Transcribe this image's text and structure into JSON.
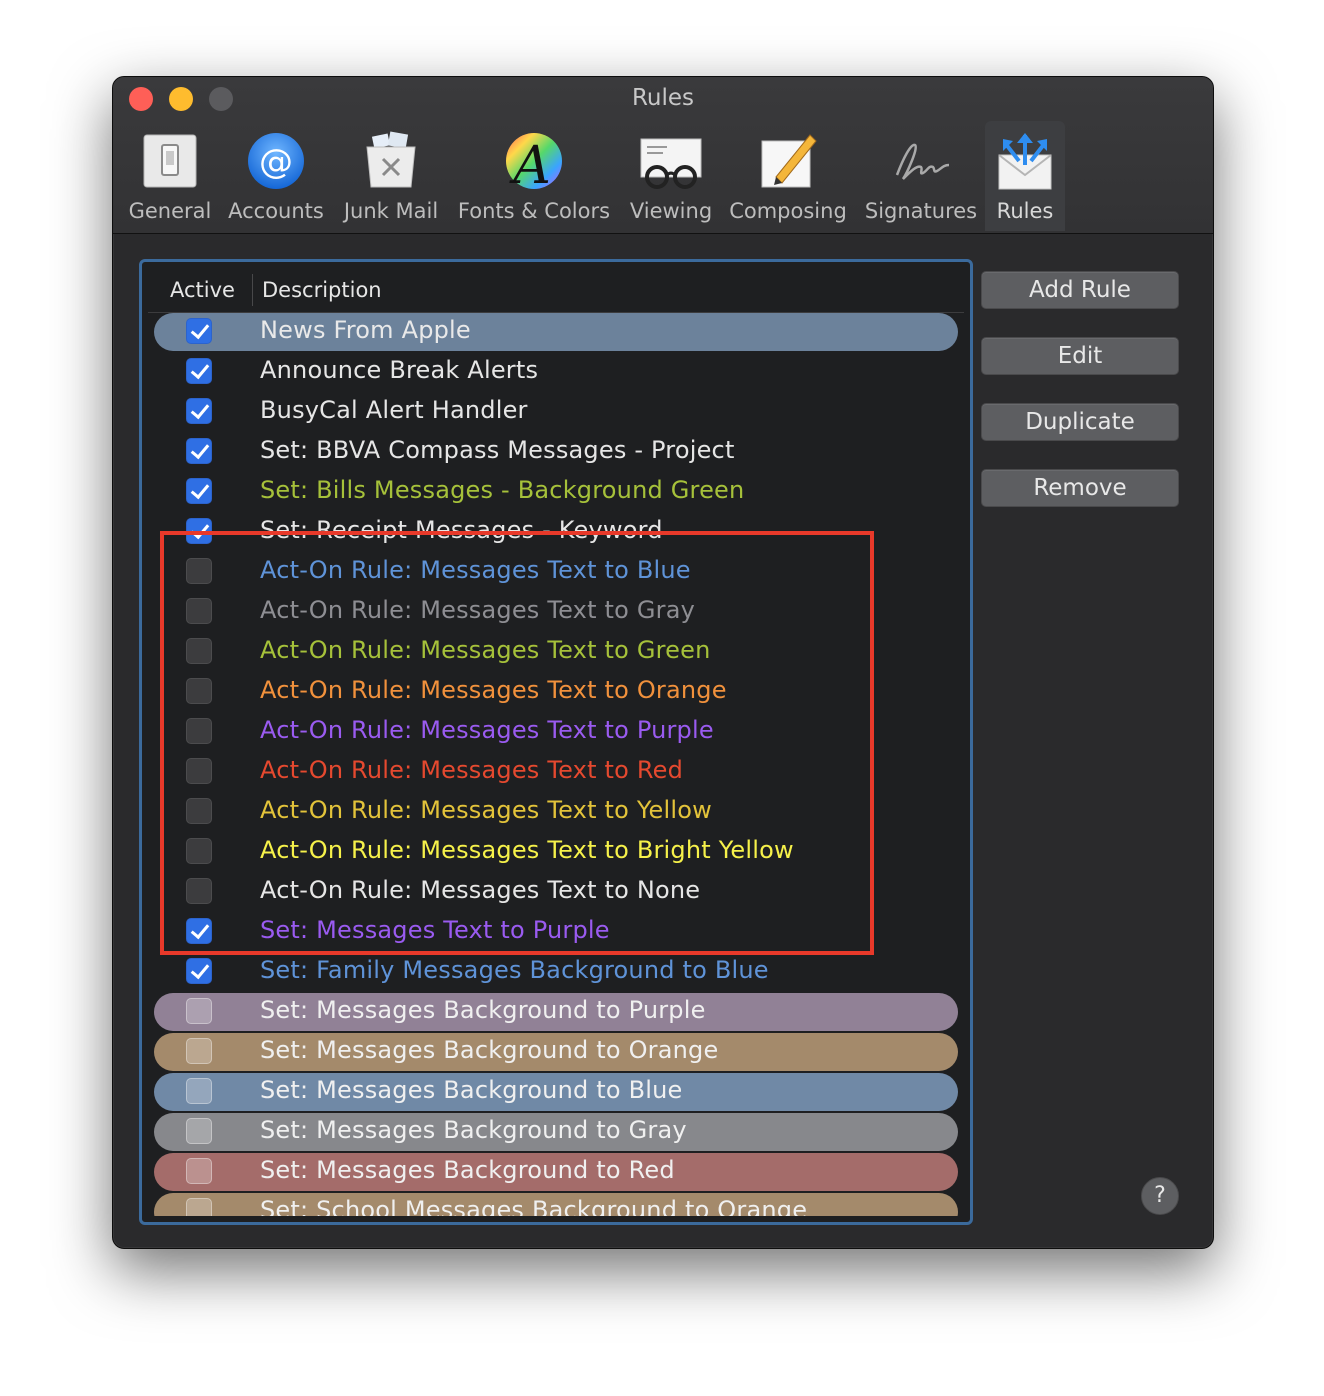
{
  "window": {
    "title": "Rules"
  },
  "toolbar": {
    "items": [
      {
        "label": "General",
        "icon": "general-icon"
      },
      {
        "label": "Accounts",
        "icon": "at-sign-icon"
      },
      {
        "label": "Junk Mail",
        "icon": "trash-basket-icon"
      },
      {
        "label": "Fonts & Colors",
        "icon": "fonts-colors-icon"
      },
      {
        "label": "Viewing",
        "icon": "glasses-icon"
      },
      {
        "label": "Composing",
        "icon": "pencil-paper-icon"
      },
      {
        "label": "Signatures",
        "icon": "signature-icon"
      },
      {
        "label": "Rules",
        "icon": "rules-envelope-icon"
      }
    ],
    "selected": "Rules"
  },
  "table": {
    "columns": [
      "Active",
      "Description"
    ],
    "rows": [
      {
        "active": true,
        "label": "News From Apple",
        "text_color": "#e9e9e9",
        "bg_color": "#6c829b"
      },
      {
        "active": true,
        "label": "Announce Break Alerts",
        "text_color": "#e6e6e6",
        "bg_color": ""
      },
      {
        "active": true,
        "label": "BusyCal Alert Handler",
        "text_color": "#e6e6e6",
        "bg_color": ""
      },
      {
        "active": true,
        "label": "Set: BBVA Compass Messages - Project",
        "text_color": "#e6e6e6",
        "bg_color": ""
      },
      {
        "active": true,
        "label": "Set: Bills Messages - Background Green",
        "text_color": "#a6c13a",
        "bg_color": ""
      },
      {
        "active": true,
        "label": "Set: Receipt Messages - Keyword",
        "text_color": "#e6e6e6",
        "bg_color": ""
      },
      {
        "active": false,
        "label": "Act-On Rule: Messages Text to Blue",
        "text_color": "#5f93d8",
        "bg_color": ""
      },
      {
        "active": false,
        "label": "Act-On Rule: Messages Text to Gray",
        "text_color": "#8e8e93",
        "bg_color": ""
      },
      {
        "active": false,
        "label": "Act-On Rule: Messages Text to Green",
        "text_color": "#a6c13a",
        "bg_color": ""
      },
      {
        "active": false,
        "label": "Act-On Rule: Messages Text to Orange",
        "text_color": "#f1913c",
        "bg_color": ""
      },
      {
        "active": false,
        "label": "Act-On Rule: Messages Text to Purple",
        "text_color": "#9a5bf0",
        "bg_color": ""
      },
      {
        "active": false,
        "label": "Act-On Rule: Messages Text to Red",
        "text_color": "#e5492f",
        "bg_color": ""
      },
      {
        "active": false,
        "label": "Act-On Rule: Messages Text to Yellow",
        "text_color": "#e3c33a",
        "bg_color": ""
      },
      {
        "active": false,
        "label": "Act-On Rule: Messages Text to Bright Yellow",
        "text_color": "#f6f14a",
        "bg_color": ""
      },
      {
        "active": false,
        "label": "Act-On Rule: Messages Text to None",
        "text_color": "#e6e6e6",
        "bg_color": ""
      },
      {
        "active": true,
        "label": "Set: Messages Text to Purple",
        "text_color": "#9a5bf0",
        "bg_color": ""
      },
      {
        "active": true,
        "label": "Set: Family Messages Background to Blue",
        "text_color": "#5f93d8",
        "bg_color": ""
      },
      {
        "active": false,
        "label": "Set: Messages Background to Purple",
        "text_color": "#f0f0f0",
        "bg_color": "#918196"
      },
      {
        "active": false,
        "label": "Set: Messages Background to Orange",
        "text_color": "#f0f0f0",
        "bg_color": "#a48a6b"
      },
      {
        "active": false,
        "label": "Set: Messages Background to Blue",
        "text_color": "#f0f0f0",
        "bg_color": "#7089a6"
      },
      {
        "active": false,
        "label": "Set: Messages Background to Gray",
        "text_color": "#f0f0f0",
        "bg_color": "#87888c"
      },
      {
        "active": false,
        "label": "Set: Messages Background to Red",
        "text_color": "#f0f0f0",
        "bg_color": "#a46c6a"
      },
      {
        "active": false,
        "label": "Set: School Messages Background to Orange",
        "text_color": "#f0f0f0",
        "bg_color": "#a48a6b"
      }
    ]
  },
  "buttons": {
    "add_rule": "Add Rule",
    "edit": "Edit",
    "duplicate": "Duplicate",
    "remove": "Remove",
    "help": "?"
  },
  "colors": {
    "selection_border": "#3b6a9c",
    "highlight_box": "#e8392a",
    "checkbox_on": "#2f6fe4"
  }
}
